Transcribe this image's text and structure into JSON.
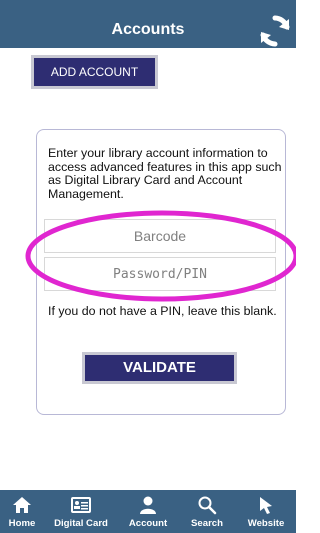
{
  "header": {
    "title": "Accounts",
    "refresh_icon": "refresh-icon"
  },
  "add_account": {
    "label": "ADD ACCOUNT"
  },
  "login_card": {
    "intro": "Enter your library account information to access advanced features in this app such as Digital Library Card and Account Management.",
    "barcode_placeholder": "Barcode",
    "barcode_value": "",
    "password_placeholder": "Password/PIN",
    "password_value": "",
    "pin_note": "If you do not have a PIN, leave this blank.",
    "validate_label": "VALIDATE",
    "highlight_color": "#e026d0"
  },
  "bottom_nav": {
    "items": [
      {
        "label": "Home",
        "icon": "home-icon"
      },
      {
        "label": "Digital Card",
        "icon": "card-icon"
      },
      {
        "label": "Account",
        "icon": "person-icon"
      },
      {
        "label": "Search",
        "icon": "search-icon"
      },
      {
        "label": "Website",
        "icon": "pointer-icon"
      }
    ]
  },
  "colors": {
    "header": "#3a6183",
    "button": "#2e2d72",
    "button_border": "#c8c8d2",
    "card_border": "#b8b8d6"
  }
}
